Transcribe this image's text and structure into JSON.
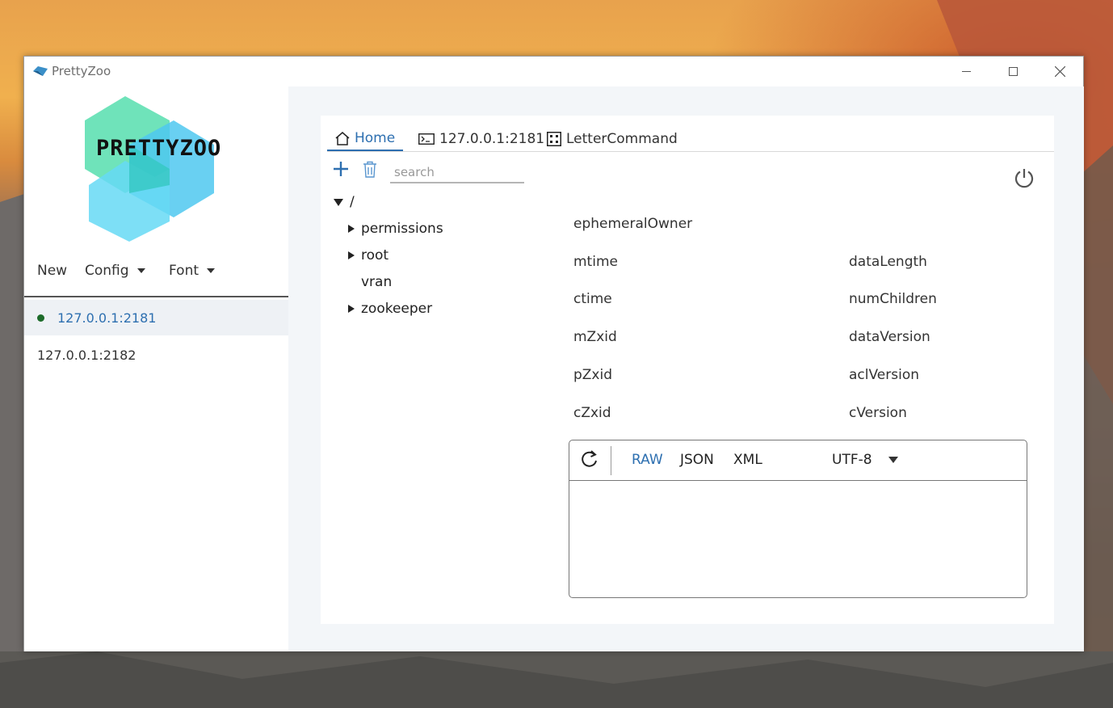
{
  "window": {
    "title": "PrettyZoo",
    "controls": {
      "minimize": "minimize-icon",
      "maximize": "maximize-icon",
      "close": "close-icon"
    }
  },
  "sidebar": {
    "logo_text": "PRETTYZOO",
    "menu": [
      {
        "label": "New",
        "has_dropdown": false
      },
      {
        "label": "Config",
        "has_dropdown": true
      },
      {
        "label": "Font",
        "has_dropdown": true
      }
    ],
    "servers": [
      {
        "address": "127.0.0.1:2181",
        "connected": true,
        "selected": true
      },
      {
        "address": "127.0.0.1:2182",
        "connected": false,
        "selected": false
      }
    ]
  },
  "tabs": [
    {
      "label": "Home",
      "icon": "home-icon",
      "active": true
    },
    {
      "label": "127.0.0.1:2181",
      "icon": "terminal-icon",
      "active": false
    },
    {
      "label": "LetterCommand",
      "icon": "command-icon",
      "active": false
    }
  ],
  "toolbar": {
    "add_icon": "plus-icon",
    "delete_icon": "trash-icon",
    "search_placeholder": "search",
    "search_value": "",
    "disconnect_icon": "power-icon"
  },
  "tree": {
    "root": {
      "label": "/",
      "expanded": true
    },
    "children": [
      {
        "label": "permissions",
        "expandable": true
      },
      {
        "label": "root",
        "expandable": true
      },
      {
        "label": "vran",
        "expandable": false
      },
      {
        "label": "zookeeper",
        "expandable": true
      }
    ]
  },
  "node_properties": {
    "ephemeralOwner": "ephemeralOwner",
    "left": [
      "mtime",
      "ctime",
      "mZxid",
      "pZxid",
      "cZxid"
    ],
    "right": [
      "dataLength",
      "numChildren",
      "dataVersion",
      "aclVersion",
      "cVersion"
    ]
  },
  "editor": {
    "refresh_icon": "refresh-icon",
    "formats": [
      {
        "label": "RAW",
        "active": true
      },
      {
        "label": "JSON",
        "active": false
      },
      {
        "label": "XML",
        "active": false
      }
    ],
    "charset": "UTF-8",
    "content": ""
  },
  "colors": {
    "accent": "#2d6fb0",
    "connected_dot": "#1d6b2a",
    "main_bg": "#f3f6f9",
    "selected_row": "#eef1f5"
  }
}
